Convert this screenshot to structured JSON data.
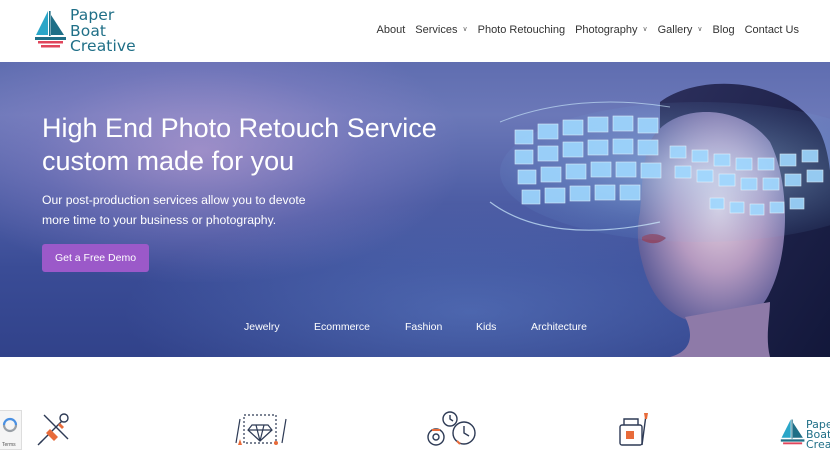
{
  "brand": {
    "line1": "Paper",
    "line2": "Boat",
    "line3": "Creative",
    "color": "#1f6f87",
    "accent_red": "#e0455b"
  },
  "nav": {
    "items": [
      {
        "label": "About",
        "has_dropdown": false
      },
      {
        "label": "Services",
        "has_dropdown": true
      },
      {
        "label": "Photo Retouching",
        "has_dropdown": false
      },
      {
        "label": "Photography",
        "has_dropdown": true
      },
      {
        "label": "Gallery",
        "has_dropdown": true
      },
      {
        "label": "Blog",
        "has_dropdown": false
      },
      {
        "label": "Contact Us",
        "has_dropdown": false
      }
    ]
  },
  "hero": {
    "title_line1": "High End Photo Retouch Service",
    "title_line2": "custom made for you",
    "subtitle_line1": "Our post-production services allow you to devote",
    "subtitle_line2": "more time to your business or photography.",
    "cta_label": "Get a Free Demo",
    "cta_color": "#9b59c9",
    "categories": [
      "Jewelry",
      "Ecommerce",
      "Fashion",
      "Kids",
      "Architecture"
    ]
  },
  "features": {
    "icons": [
      "tools-icon",
      "diamond-sketch-icon",
      "gears-clock-icon",
      "paint-supplies-icon"
    ]
  },
  "recaptcha": {
    "terms": "Terms"
  }
}
